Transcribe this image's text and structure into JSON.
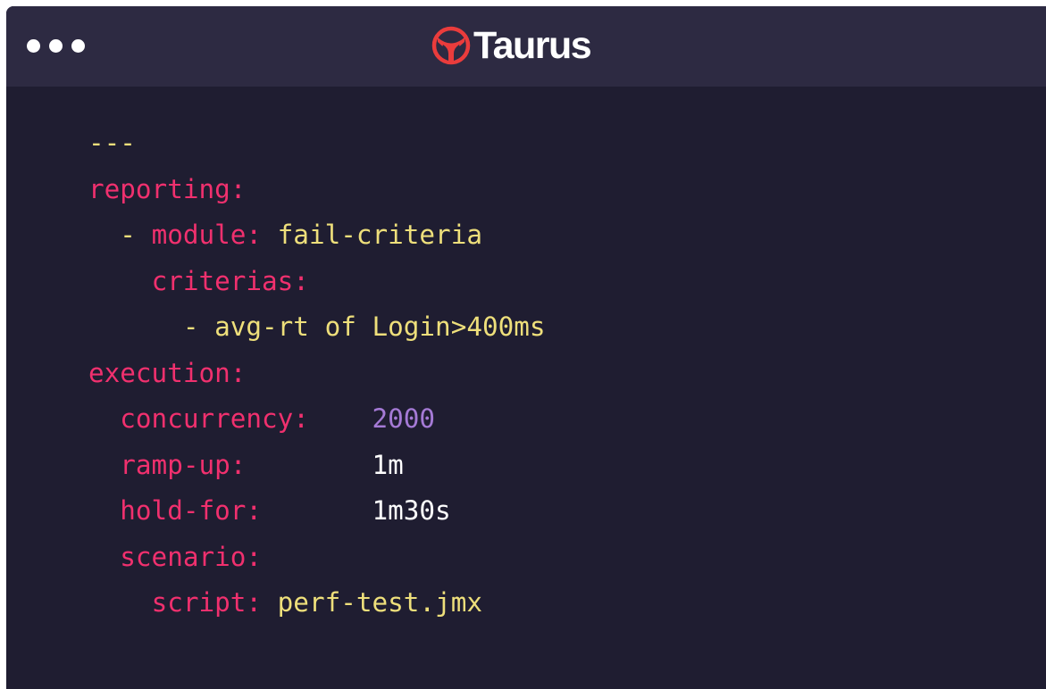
{
  "app": {
    "brand": "Taurus",
    "brand_icon": "taurus-bull-logo-icon",
    "colors": {
      "window_bg": "#1f1d31",
      "titlebar_bg": "#2d2a42",
      "key": "#f0306e",
      "string": "#eedf7b",
      "number": "#a57ad6",
      "plain": "#ffffff",
      "logo_red": "#ea3c3c"
    }
  },
  "code": {
    "separator": "---",
    "reporting_key": "reporting:",
    "module_dash": "- ",
    "module_key": "module:",
    "module_value": "fail-criteria",
    "criterias_key": "criterias:",
    "criteria_item": "- avg-rt of Login>400ms",
    "execution_key": "execution:",
    "concurrency_key": "concurrency:",
    "concurrency_value": "2000",
    "rampup_key": "ramp-up:",
    "rampup_value": "1m",
    "holdfor_key": "hold-for:",
    "holdfor_value": "1m30s",
    "scenario_key": "scenario:",
    "script_key": "script:",
    "script_value": "perf-test.jmx"
  }
}
